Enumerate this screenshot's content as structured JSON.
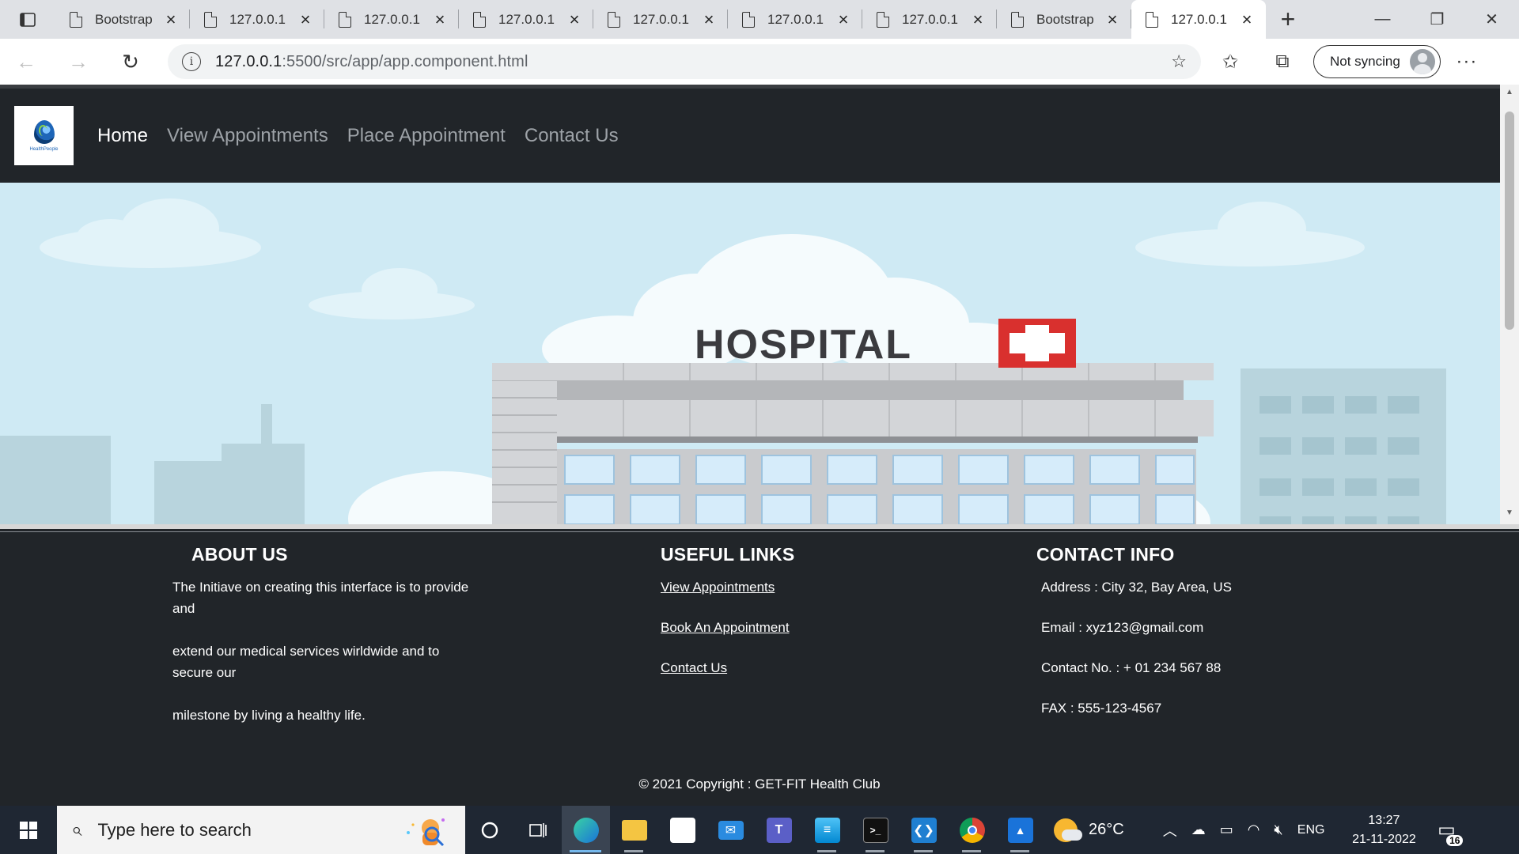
{
  "browser": {
    "tabs": [
      {
        "title": "Bootstrap",
        "active": false
      },
      {
        "title": "127.0.0.1",
        "active": false
      },
      {
        "title": "127.0.0.1",
        "active": false
      },
      {
        "title": "127.0.0.1",
        "active": false
      },
      {
        "title": "127.0.0.1",
        "active": false
      },
      {
        "title": "127.0.0.1",
        "active": false
      },
      {
        "title": "127.0.0.1",
        "active": false
      },
      {
        "title": "Bootstrap",
        "active": false
      },
      {
        "title": "127.0.0.1",
        "active": true
      }
    ],
    "url_host": "127.0.0.1",
    "url_path": ":5500/src/app/app.component.html",
    "sync_label": "Not syncing"
  },
  "site": {
    "logo_text": "HealthPeople",
    "nav": {
      "home": "Home",
      "view": "View Appointments",
      "place": "Place Appointment",
      "contact": "Contact Us"
    },
    "hero": {
      "sign_text": "HOSPITAL"
    },
    "footer": {
      "about_title": "ABOUT US",
      "about_paragraphs": [
        "The Initiave on creating this interface is to provide and",
        "extend our medical services wirldwide and to secure our",
        "milestone by living a healthy life."
      ],
      "links_title": "USEFUL LINKS",
      "links": [
        "View Appointments",
        "Book An Appointment",
        "Contact Us"
      ],
      "contact_title": "CONTACT INFO",
      "contact_lines": [
        "Address : City 32, Bay Area, US",
        "Email : xyz123@gmail.com",
        "Contact No. : + 01 234 567 88",
        "FAX : 555-123-4567"
      ],
      "copyright": "© 2021 Copyright : GET-FIT Health Club"
    }
  },
  "taskbar": {
    "search_placeholder": "Type here to search",
    "weather": "26°C",
    "language": "ENG",
    "time": "13:27",
    "date": "21-11-2022",
    "notifications": "16"
  },
  "colors": {
    "navbar_bg": "#212529",
    "hero_sky": "#cfeaf4",
    "hospital_red": "#d9302e",
    "taskbar_bg": "#1f2733"
  }
}
